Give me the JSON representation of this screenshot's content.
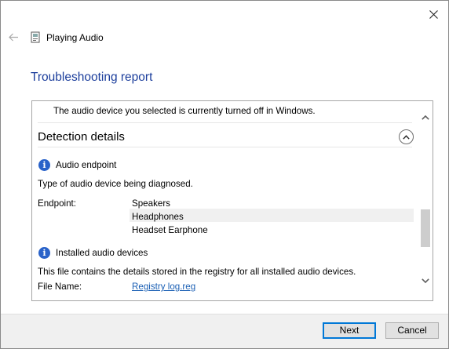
{
  "window": {
    "title": "Playing Audio",
    "close_icon": "close-icon",
    "back_icon": "back-arrow-icon"
  },
  "heading": "Troubleshooting report",
  "report": {
    "message": "The audio device you selected is currently turned off in Windows.",
    "detection_title": "Detection details",
    "endpoint_section": {
      "title": "Audio endpoint",
      "description": "Type of audio device being diagnosed.",
      "field_label": "Endpoint:",
      "values": [
        "Speakers",
        "Headphones",
        "Headset Earphone"
      ]
    },
    "installed_section": {
      "title": "Installed audio devices",
      "description": "This file contains the details stored in the registry for all installed audio devices.",
      "file_label": "File Name:",
      "file_link": "Registry log.reg"
    }
  },
  "buttons": {
    "next": "Next",
    "cancel": "Cancel"
  },
  "colors": {
    "heading": "#1c3e9c",
    "link": "#1a5fb4",
    "accent": "#0078d7",
    "info": "#2962c9"
  }
}
